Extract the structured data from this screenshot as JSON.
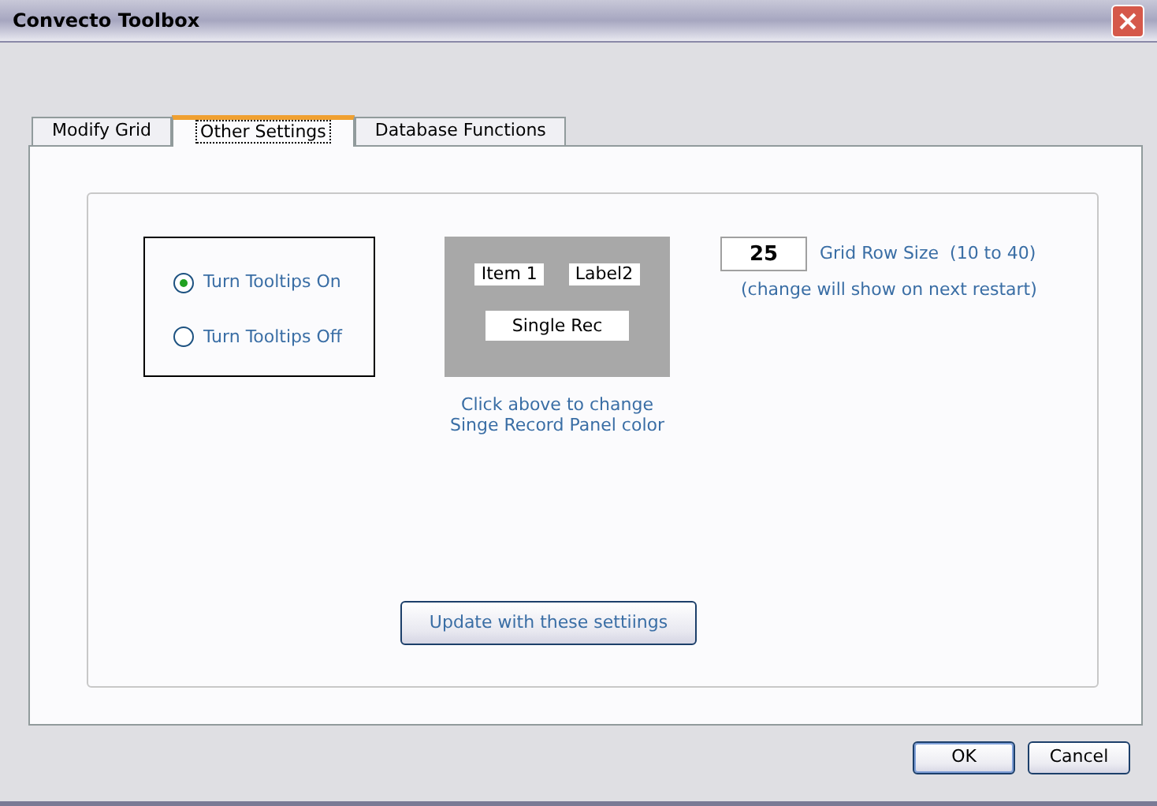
{
  "window": {
    "title": "Convecto Toolbox"
  },
  "tabs": [
    {
      "label": "Modify Grid",
      "selected": false
    },
    {
      "label": "Other Settings",
      "selected": true
    },
    {
      "label": "Database Functions",
      "selected": false
    }
  ],
  "tooltip_options": [
    {
      "label": "Turn Tooltips On",
      "selected": true
    },
    {
      "label": "Turn Tooltips Off",
      "selected": false
    }
  ],
  "panel_preview": {
    "labels": [
      "Item 1",
      "Label2"
    ],
    "record_label": "Single Rec",
    "caption_lines": [
      "Click above to change",
      "Singe Record Panel color"
    ]
  },
  "grid_row_size": {
    "value": "25",
    "label": "Grid Row Size  (10 to 40)",
    "note": "(change will show on next restart)"
  },
  "update_button": "Update with these settiings",
  "buttons": [
    {
      "label": "OK",
      "kind": "default"
    },
    {
      "label": "Cancel",
      "kind": "normal"
    }
  ]
}
